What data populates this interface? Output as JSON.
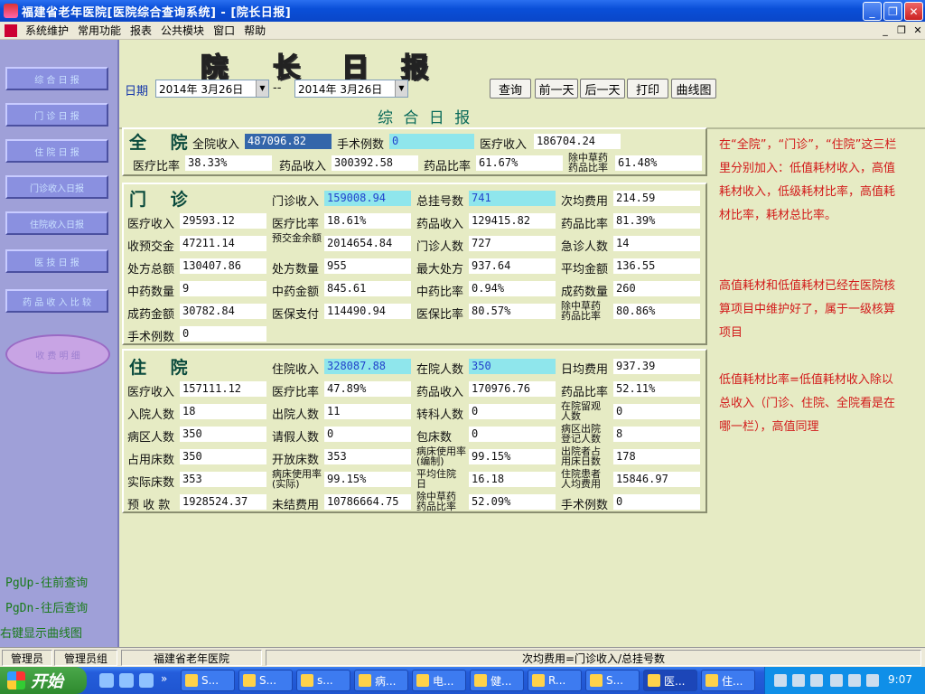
{
  "window": {
    "title": "福建省老年医院[医院综合查询系统] - [院长日报]"
  },
  "menu": [
    "系统维护",
    "常用功能",
    "报表",
    "公共模块",
    "窗口",
    "帮助"
  ],
  "sidebar": {
    "buttons": [
      "综 合 日 报",
      "门 诊 日 报",
      "住 院 日 报",
      "门诊收入日报",
      "住院收入日报",
      "医 技 日 报",
      "药 品 收 入 比 较"
    ],
    "oval": "收 费 明 细",
    "hints": [
      "PgUp-往前查询",
      "PgDn-往后查询",
      "右键显示曲线图"
    ]
  },
  "header": {
    "title_chars": [
      "院",
      "长",
      "日",
      "报"
    ],
    "date_label": "日期",
    "date_from": "2014年 3月26日",
    "date_sep": "--",
    "date_to": "2014年 3月26日",
    "buttons": [
      "查询",
      "前一天",
      "后一天",
      "打印",
      "曲线图"
    ],
    "subtitle": "综 合 日 报"
  },
  "quanyuan": {
    "title": "全 院",
    "fields": [
      {
        "label": "全院收入",
        "value": "487096.82"
      },
      {
        "label": "手术例数",
        "value": "0"
      },
      {
        "label": "医疗收入",
        "value": "186704.24"
      },
      {
        "label": "医疗比率",
        "value": "38.33%"
      },
      {
        "label": "药品收入",
        "value": "300392.58"
      },
      {
        "label": "药品比率",
        "value": "61.67%"
      },
      {
        "label": "除中草药药品比率",
        "value": "61.48%"
      }
    ]
  },
  "menzhen": {
    "title": "门 诊",
    "fields": [
      {
        "label": "门诊收入",
        "value": "159008.94"
      },
      {
        "label": "总挂号数",
        "value": "741"
      },
      {
        "label": "次均费用",
        "value": "214.59"
      },
      {
        "label": "医疗收入",
        "value": "29593.12"
      },
      {
        "label": "医疗比率",
        "value": "18.61%"
      },
      {
        "label": "药品收入",
        "value": "129415.82"
      },
      {
        "label": "药品比率",
        "value": "81.39%"
      },
      {
        "label": "收预交金",
        "value": "47211.14"
      },
      {
        "label": "预交金余额",
        "value": "2014654.84"
      },
      {
        "label": "门诊人数",
        "value": "727"
      },
      {
        "label": "急诊人数",
        "value": "14"
      },
      {
        "label": "处方总额",
        "value": "130407.86"
      },
      {
        "label": "处方数量",
        "value": "955"
      },
      {
        "label": "最大处方",
        "value": "937.64"
      },
      {
        "label": "平均金额",
        "value": "136.55"
      },
      {
        "label": "中药数量",
        "value": "9"
      },
      {
        "label": "中药金额",
        "value": "845.61"
      },
      {
        "label": "中药比率",
        "value": "0.94%"
      },
      {
        "label": "成药数量",
        "value": "260"
      },
      {
        "label": "成药金额",
        "value": "30782.84"
      },
      {
        "label": "医保支付",
        "value": "114490.94"
      },
      {
        "label": "医保比率",
        "value": "80.57%"
      },
      {
        "label": "除中草药药品比率",
        "value": "80.86%"
      },
      {
        "label": "手术例数",
        "value": "0"
      }
    ]
  },
  "zhuyuan": {
    "title": "住 院",
    "fields": [
      {
        "label": "住院收入",
        "value": "328087.88"
      },
      {
        "label": "在院人数",
        "value": "350"
      },
      {
        "label": "日均费用",
        "value": "937.39"
      },
      {
        "label": "医疗收入",
        "value": "157111.12"
      },
      {
        "label": "医疗比率",
        "value": "47.89%"
      },
      {
        "label": "药品收入",
        "value": "170976.76"
      },
      {
        "label": "药品比率",
        "value": "52.11%"
      },
      {
        "label": "入院人数",
        "value": "18"
      },
      {
        "label": "出院人数",
        "value": "11"
      },
      {
        "label": "转科人数",
        "value": "0"
      },
      {
        "label": "在院留观人数",
        "value": "0"
      },
      {
        "label": "病区人数",
        "value": "350"
      },
      {
        "label": "请假人数",
        "value": "0"
      },
      {
        "label": "包床数",
        "value": "0"
      },
      {
        "label": "病区出院登记人数",
        "value": "8"
      },
      {
        "label": "占用床数",
        "value": "350"
      },
      {
        "label": "开放床数",
        "value": "353"
      },
      {
        "label": "病床使用率(编制)",
        "value": "99.15%"
      },
      {
        "label": "出院者占用床日数",
        "value": "178"
      },
      {
        "label": "实际床数",
        "value": "353"
      },
      {
        "label": "病床使用率(实际)",
        "value": "99.15%"
      },
      {
        "label": "平均住院日",
        "value": "16.18"
      },
      {
        "label": "住院患者人均费用",
        "value": "15846.97"
      },
      {
        "label": "预 收 款",
        "value": "1928524.37"
      },
      {
        "label": "未结费用",
        "value": "10786664.75"
      },
      {
        "label": "除中草药药品比率",
        "value": "52.09%"
      },
      {
        "label": "手术例数",
        "value": "0"
      }
    ]
  },
  "notes": [
    "在“全院”，“门诊”，“住院”这三栏里分别加入：低值耗材收入，高值耗材收入，低级耗材比率，高值耗材比率，耗材总比率。",
    "高值耗材和低值耗材已经在医院核算项目中维护好了，属于一级核算项目",
    "低值耗材比率=低值耗材收入除以总收入（门诊、住院、全院看是在哪一栏），高值同理"
  ],
  "status": {
    "user": "管理员",
    "group": "管理员组",
    "hospital": "福建省老年医院",
    "formula": "次均费用=门诊收入/总挂号数"
  },
  "taskbar": {
    "start": "开始",
    "items": [
      "S...",
      "S...",
      "s...",
      "病...",
      "电...",
      "健...",
      "R...",
      "S...",
      "医...",
      "住..."
    ],
    "clock": "9:07"
  }
}
